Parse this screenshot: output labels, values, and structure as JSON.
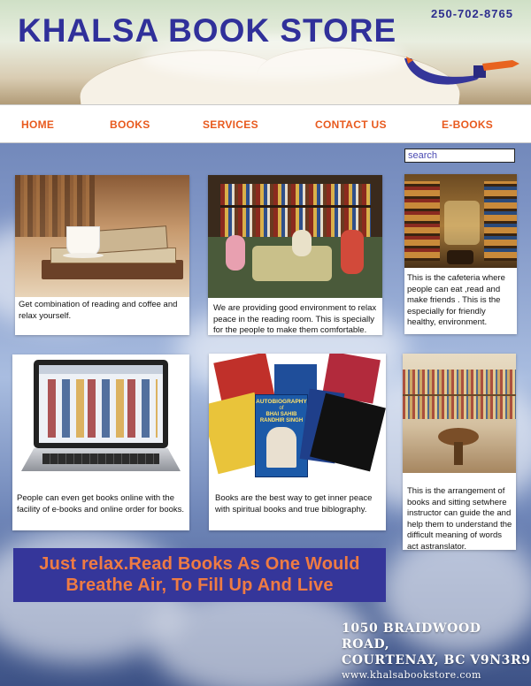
{
  "header": {
    "title": "KHALSA BOOK STORE",
    "phone": "250-702-8765"
  },
  "nav": {
    "items": [
      {
        "label": "HOME"
      },
      {
        "label": "BOOKS"
      },
      {
        "label": "SERVICES"
      },
      {
        "label": "CONTACT US"
      },
      {
        "label": "E-BOOKS"
      }
    ]
  },
  "search": {
    "placeholder": "search"
  },
  "cards": [
    {
      "caption": "Get combination of reading and coffee and relax yourself."
    },
    {
      "caption": "We are providing good environment to relax peace in the reading room. This is specially for the people to make them comfortable."
    },
    {
      "caption": "This is the cafeteria where people can eat ,read and make friends . This is the especially for friendly healthy, environment."
    },
    {
      "caption": "People can even get books online with the facility of e-books and online order for books."
    },
    {
      "caption": "Books are the best way to get inner peace with spiritual books and true biblography."
    },
    {
      "caption": "This is the arrangement of books and sitting  setwhere instructor can guide the and help them to understand the difficult meaning of words act astranslator."
    }
  ],
  "book_covers": {
    "autobiography": "AUTOBIOGRAPHY",
    "of": "of",
    "author": "BHAI SAHIB RANDHIR SINGH"
  },
  "banner": {
    "line1": "Just relax.Read Books As One Would",
    "line2": "Breathe Air, To Fill Up And Live"
  },
  "address": {
    "line1": "1050 BRAIDWOOD ROAD,",
    "line2": "COURTENAY, BC V9N3R9",
    "website": "www.khalsabookstore.com"
  },
  "colors": {
    "title": "#30309a",
    "nav": "#e85a1e",
    "banner_bg": "#35369a",
    "banner_text": "#ef7b43"
  }
}
